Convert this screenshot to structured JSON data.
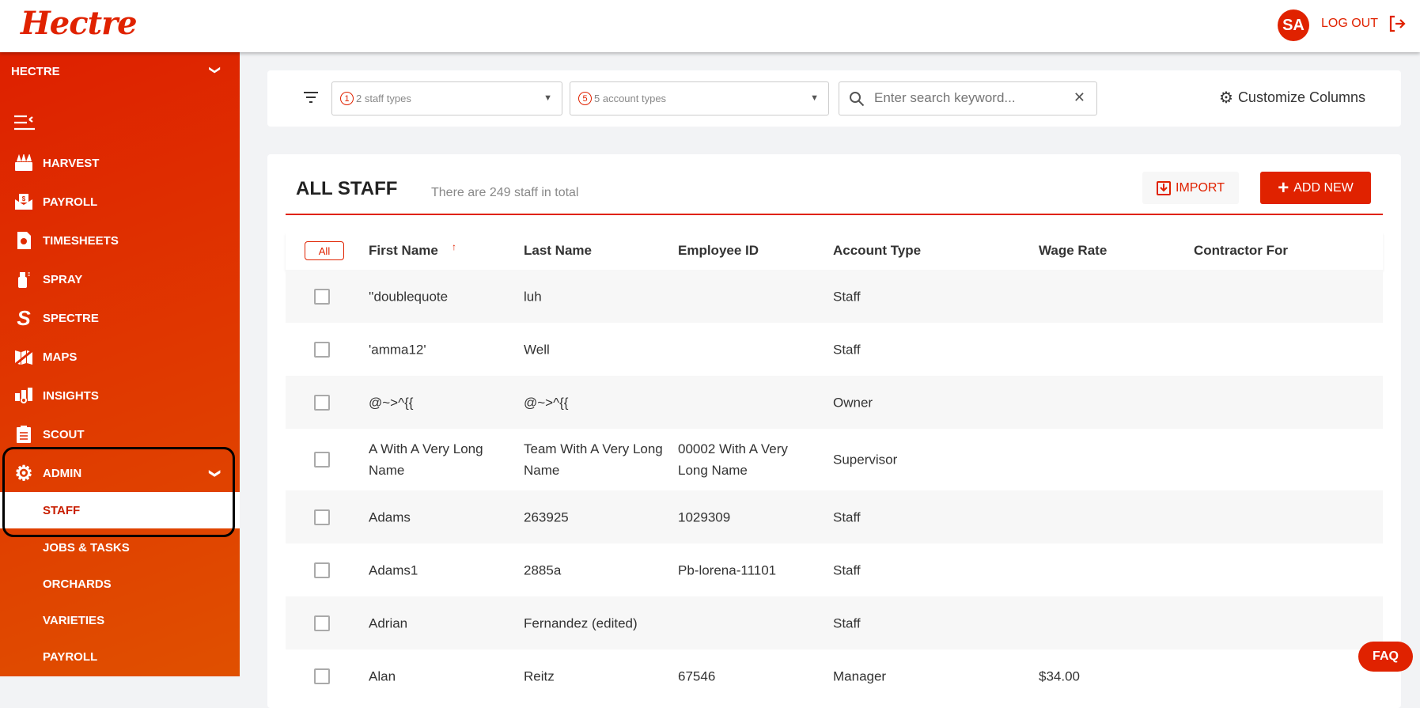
{
  "header": {
    "logo": "Hectre",
    "avatar": "SA",
    "logout": "LOG OUT"
  },
  "sidebar": {
    "org": "HECTRE",
    "items": [
      {
        "label": "HARVEST",
        "icon": "harvest-icon"
      },
      {
        "label": "PAYROLL",
        "icon": "payroll-icon"
      },
      {
        "label": "TIMESHEETS",
        "icon": "timesheets-icon"
      },
      {
        "label": "SPRAY",
        "icon": "spray-icon"
      },
      {
        "label": "SPECTRE",
        "icon": "spectre-icon"
      },
      {
        "label": "MAPS",
        "icon": "maps-icon"
      },
      {
        "label": "INSIGHTS",
        "icon": "insights-icon"
      },
      {
        "label": "SCOUT",
        "icon": "scout-icon"
      },
      {
        "label": "ADMIN",
        "icon": "gear-icon"
      }
    ],
    "admin_sub": [
      "STAFF",
      "JOBS & TASKS",
      "ORCHARDS",
      "VARIETIES",
      "PAYROLL"
    ]
  },
  "filters": {
    "staff_types": {
      "count": "1",
      "label": "2 staff types"
    },
    "account_types": {
      "count": "5",
      "label": "5 account types"
    },
    "search_placeholder": "Enter search keyword...",
    "customize": "Customize Columns"
  },
  "table": {
    "title": "ALL STAFF",
    "subtitle": "There are 249 staff in total",
    "import": "IMPORT",
    "add_new": "ADD NEW",
    "all": "All",
    "columns": [
      "First Name",
      "Last Name",
      "Employee ID",
      "Account Type",
      "Wage Rate",
      "Contractor For"
    ],
    "rows": [
      [
        "''doublequote",
        "luh",
        "",
        "Staff",
        "",
        ""
      ],
      [
        "'amma12'",
        "Well",
        "",
        "Staff",
        "",
        ""
      ],
      [
        "@~>^{{",
        "@~>^{{",
        "",
        "Owner",
        "",
        ""
      ],
      [
        "A With A Very Long Name",
        "Team With A Very Long Name",
        "00002 With A Very Long Name",
        "Supervisor",
        "",
        ""
      ],
      [
        "Adams",
        "263925",
        "1029309",
        "Staff",
        "",
        ""
      ],
      [
        "Adams1",
        "2885a",
        "Pb-lorena-11101",
        "Staff",
        "",
        ""
      ],
      [
        "Adrian",
        "Fernandez (edited)",
        "",
        "Staff",
        "",
        ""
      ],
      [
        "Alan",
        "Reitz",
        "67546",
        "Manager",
        "$34.00",
        ""
      ]
    ]
  },
  "faq": "FAQ"
}
